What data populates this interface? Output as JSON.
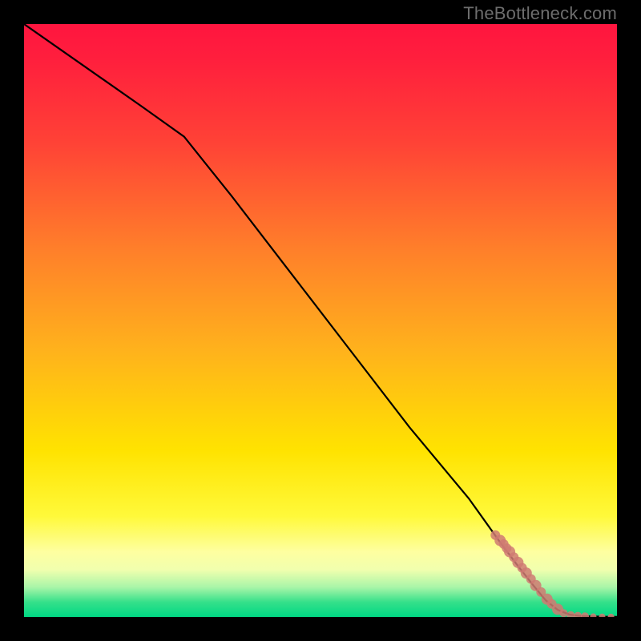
{
  "attribution": "TheBottleneck.com",
  "colors": {
    "line": "#000000",
    "marker_fill": "#cf7a72",
    "marker_stroke": "#cf7a72"
  },
  "chart_data": {
    "type": "line",
    "title": "",
    "xlabel": "",
    "ylabel": "",
    "xlim": [
      0,
      100
    ],
    "ylim": [
      0,
      100
    ],
    "grid": false,
    "series": [
      {
        "name": "curve",
        "x": [
          0,
          10,
          20,
          27,
          35,
          45,
          55,
          65,
          75,
          80,
          83,
          86,
          88,
          90,
          92,
          94,
          96,
          98,
          100
        ],
        "y": [
          100,
          93,
          86,
          81,
          71,
          58,
          45,
          32,
          20,
          13,
          9,
          5.2,
          2.8,
          1.2,
          0.4,
          0.15,
          0.08,
          0.04,
          0.02
        ]
      }
    ],
    "markers": {
      "name": "dots",
      "x": [
        79.5,
        80.3,
        80.9,
        81.4,
        81.9,
        82.6,
        83.3,
        84.0,
        84.7,
        85.5,
        86.3,
        87.2,
        88.2,
        89.0,
        90.0,
        91.0,
        92.2,
        93.4,
        94.6,
        96.0,
        97.5,
        99.0
      ],
      "y": [
        13.8,
        12.9,
        12.3,
        11.6,
        11.0,
        10.1,
        9.2,
        8.3,
        7.4,
        6.4,
        5.3,
        4.2,
        3.0,
        2.2,
        1.3,
        0.65,
        0.3,
        0.18,
        0.1,
        0.06,
        0.04,
        0.02
      ],
      "r": [
        6,
        7,
        6,
        6,
        7,
        6,
        7,
        6,
        7,
        6,
        7,
        6,
        7,
        6,
        7,
        5,
        5,
        5,
        5,
        4,
        4,
        4
      ]
    }
  }
}
